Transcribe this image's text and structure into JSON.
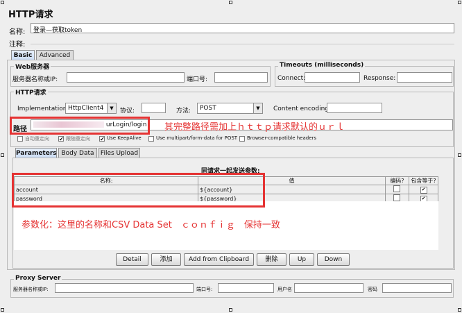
{
  "panel": {
    "title": "HTTP请求",
    "name_label": "名称:",
    "name_value": "登录—获取token",
    "comment_label": "注释:",
    "comment_value": ""
  },
  "tabs_top": [
    "Basic",
    "Advanced"
  ],
  "web_server": {
    "title": "Web服务器",
    "server_label": "服务器名称或IP:",
    "server_value": "",
    "port_label": "端口号:",
    "port_value": ""
  },
  "timeouts": {
    "title": "Timeouts (milliseconds)",
    "connect_label": "Connect:",
    "connect_value": "",
    "response_label": "Response:",
    "response_value": ""
  },
  "http_request": {
    "title": "HTTP请求",
    "impl_label": "Implementation:",
    "impl_value": "HttpClient4",
    "protocol_label": "协议:",
    "protocol_value": "",
    "method_label": "方法:",
    "method_value": "POST",
    "encoding_label": "Content encoding:",
    "encoding_value": "",
    "path_label": "路径",
    "path_value": "urLogin/login",
    "checkboxes": [
      {
        "label": "自动重定向",
        "checked": false
      },
      {
        "label": "跟随重定向",
        "checked": true
      },
      {
        "label": "Use KeepAlive",
        "checked": true
      },
      {
        "label": "Use multipart/form-data for POST",
        "checked": false
      },
      {
        "label": "Browser-compatible headers",
        "checked": false
      }
    ]
  },
  "tabs_params": [
    "Parameters",
    "Body Data",
    "Files Upload"
  ],
  "params": {
    "caption": "同请求一起发送参数:",
    "headers": [
      "名称:",
      "值",
      "编码?",
      "包含等于?"
    ],
    "rows": [
      {
        "name": "account",
        "value": "${account}",
        "encode": false,
        "include_equals": true
      },
      {
        "name": "password",
        "value": "${password}",
        "encode": false,
        "include_equals": true
      }
    ]
  },
  "buttons": [
    "Detail",
    "添加",
    "Add from Clipboard",
    "删除",
    "Up",
    "Down"
  ],
  "proxy": {
    "title": "Proxy Server",
    "server_label": "服务器名称或IP:",
    "port_label": "端口号:",
    "user_label": "用户名",
    "password_label": "密码"
  },
  "annotations": {
    "path_note": "其完整路径需加上ｈｔｔｐ请求默认的ｕｒｌ",
    "params_note": "参数化：这里的名称和CSV Data Set　ｃｏｎｆｉｇ　保持一致"
  },
  "colors": {
    "annotation": "#e53333",
    "tab_active": "#c8daf3"
  }
}
